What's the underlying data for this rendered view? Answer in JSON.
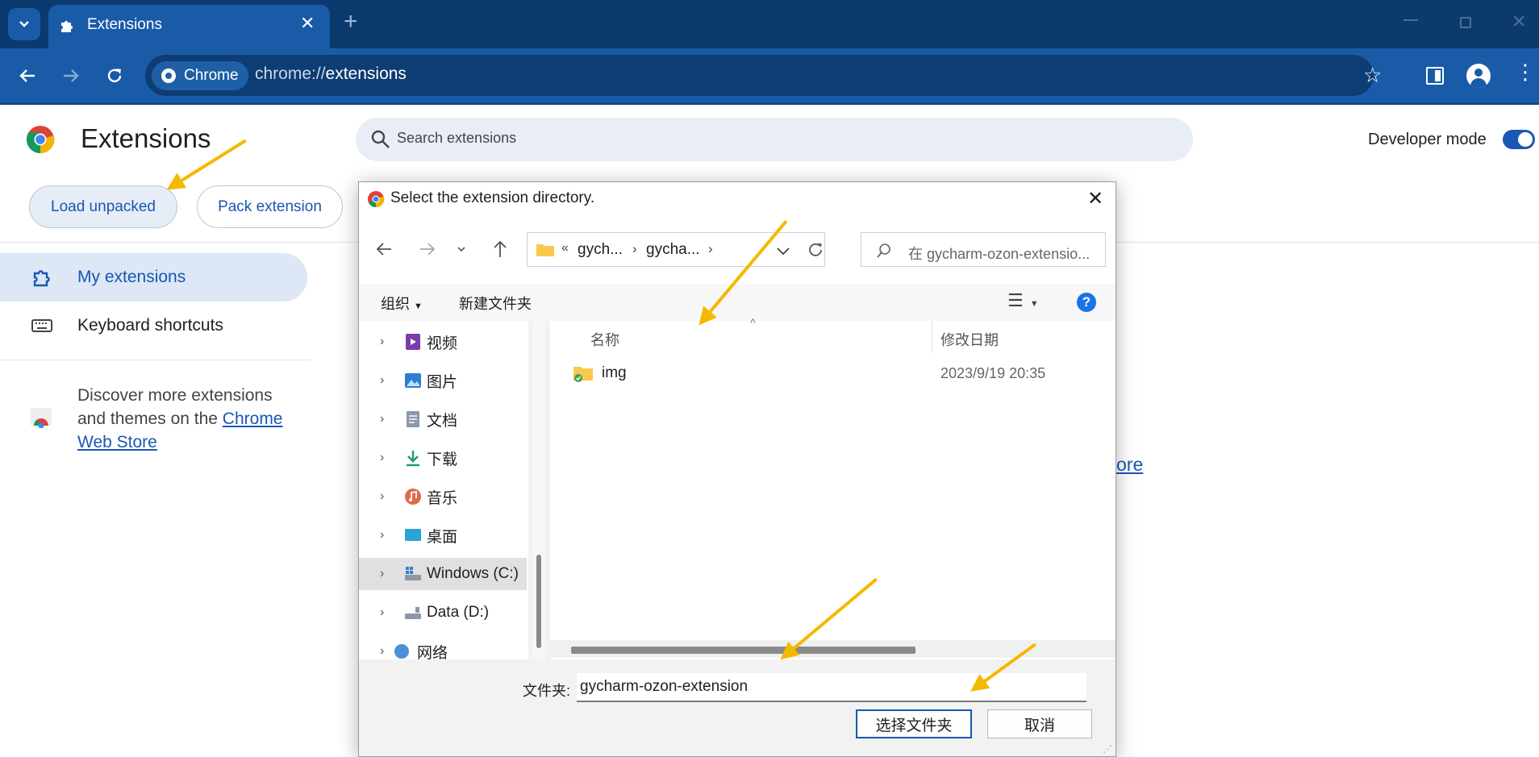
{
  "browser": {
    "tab_title": "Extensions",
    "new_tab": "+",
    "chip_label": "Chrome",
    "url_scheme": "chrome://",
    "url_path": "extensions"
  },
  "header": {
    "title": "Extensions",
    "search_placeholder": "Search extensions",
    "developer_mode_label": "Developer mode"
  },
  "actions": {
    "load_unpacked": "Load unpacked",
    "pack_extension": "Pack extension"
  },
  "sidebar": {
    "items": [
      {
        "label": "My extensions"
      },
      {
        "label": "Keyboard shortcuts"
      }
    ],
    "discover_text_1": "Discover more extensions",
    "discover_text_2": "and themes on the ",
    "discover_link_1": "Chrome",
    "discover_link_2": "Web Store"
  },
  "background_link_fragment": "ore",
  "dialog": {
    "title": "Select the extension directory.",
    "breadcrumb_prefix": "«",
    "breadcrumb": [
      "gych...",
      "gycha..."
    ],
    "search_placeholder": "在 gycharm-ozon-extensio...",
    "organize": "组织",
    "new_folder": "新建文件夹",
    "help": "?",
    "tree": [
      {
        "label": "视频",
        "icon": "video-icon"
      },
      {
        "label": "图片",
        "icon": "pictures-icon"
      },
      {
        "label": "文档",
        "icon": "documents-icon"
      },
      {
        "label": "下载",
        "icon": "download-icon"
      },
      {
        "label": "音乐",
        "icon": "music-icon"
      },
      {
        "label": "桌面",
        "icon": "desktop-icon"
      },
      {
        "label": "Windows (C:)",
        "icon": "drive-c-icon"
      },
      {
        "label": "Data (D:)",
        "icon": "drive-d-icon"
      },
      {
        "label": "网络",
        "icon": "network-icon"
      }
    ],
    "columns": {
      "name": "名称",
      "date": "修改日期"
    },
    "files": [
      {
        "name": "img",
        "date": "2023/9/19 20:35"
      }
    ],
    "folder_label": "文件夹:",
    "folder_value": "gycharm-ozon-extension",
    "select_button": "选择文件夹",
    "cancel_button": "取消"
  },
  "colors": {
    "tabbar": "#0b3b6e",
    "toolbar": "#1a5ba8",
    "accent": "#1a56b4",
    "arrow": "#f5b800"
  }
}
